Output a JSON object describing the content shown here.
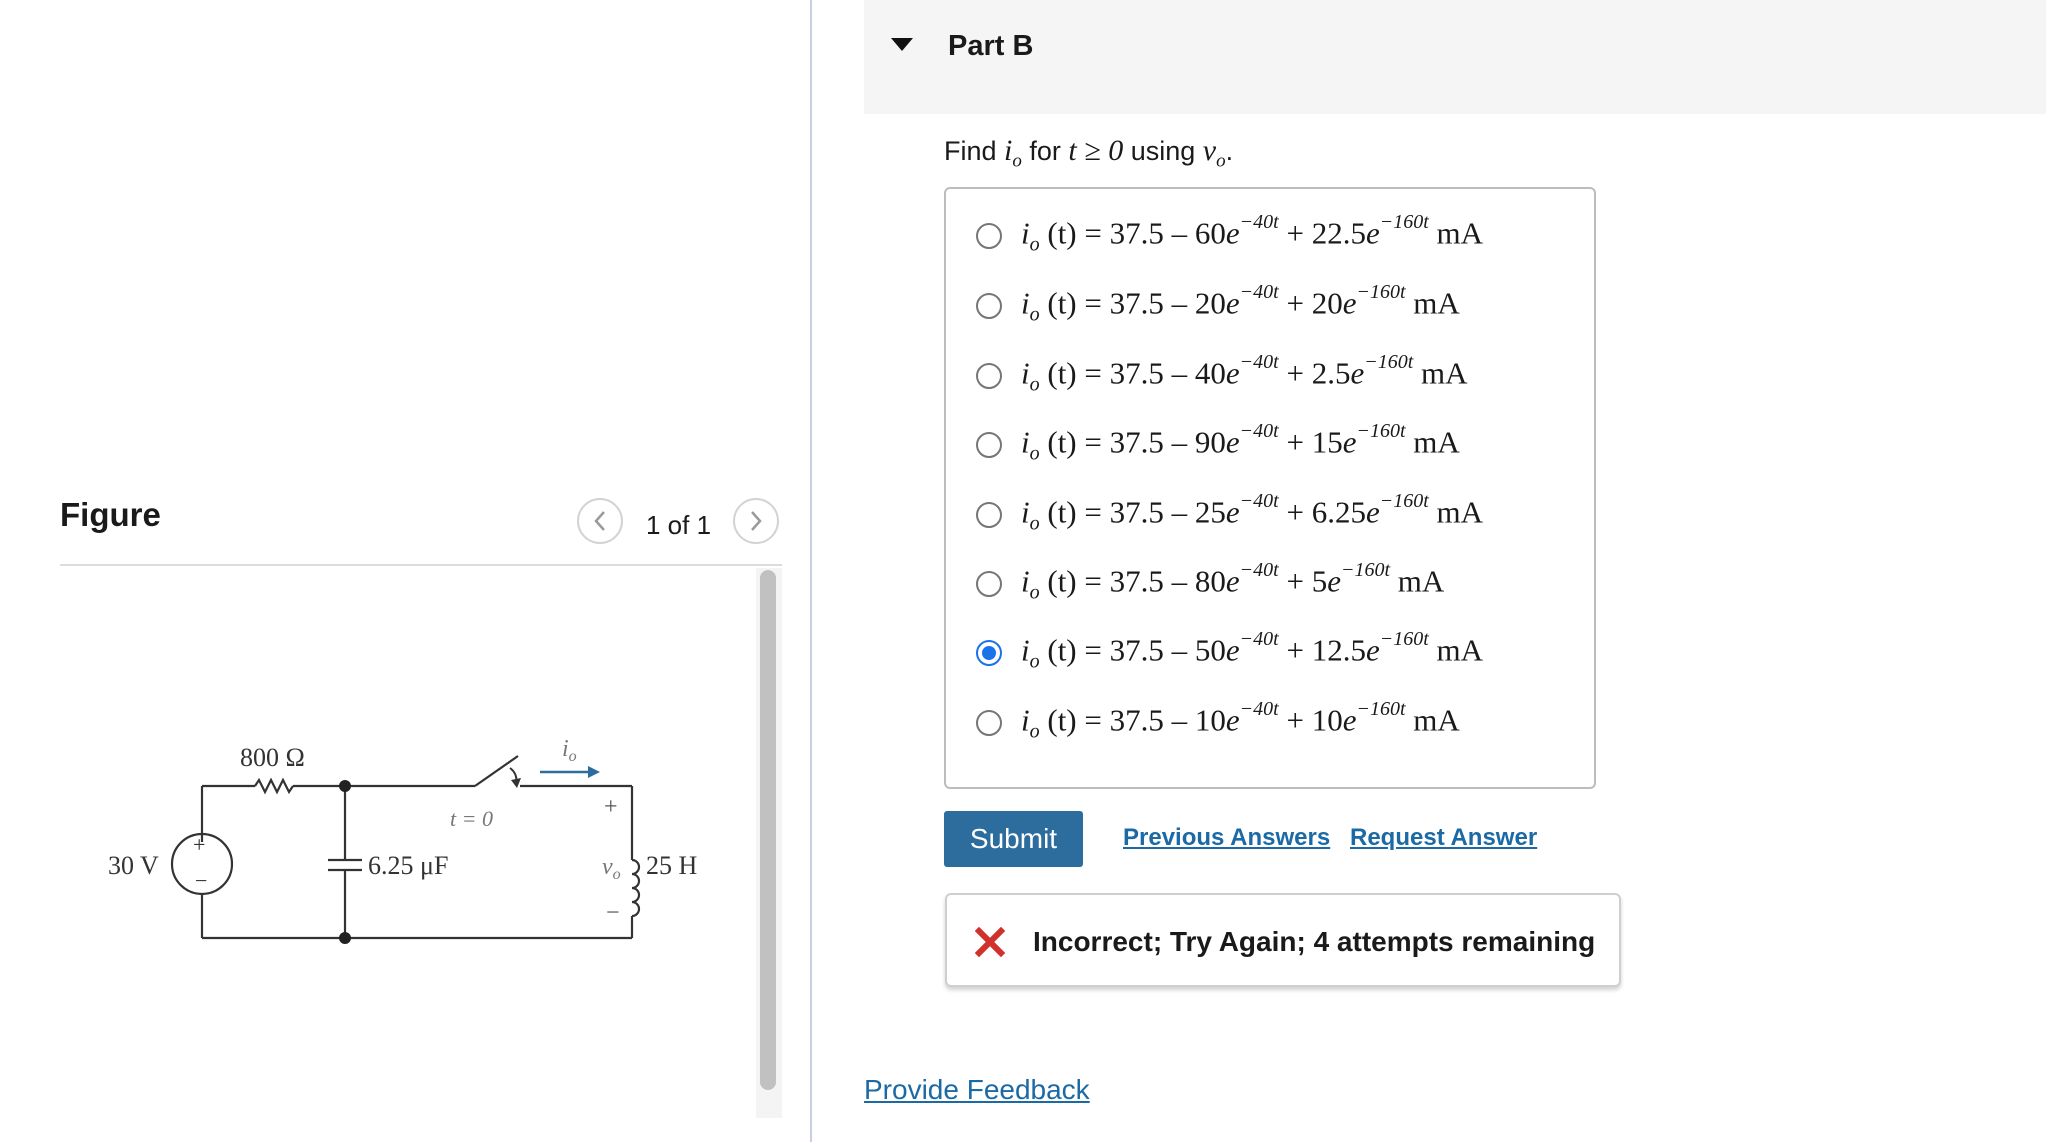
{
  "figure": {
    "title": "Figure",
    "page_counter": "1 of 1",
    "circuit": {
      "resistor_label": "800 Ω",
      "source_label": "30 V",
      "capacitor_label": "6.25 μF",
      "inductor_label": "25 H",
      "switch_label": "t = 0",
      "current_label": "i",
      "current_sub": "o",
      "voltage_label": "v",
      "voltage_sub": "o",
      "plus": "+",
      "minus": "−"
    }
  },
  "part": {
    "title": "Part B",
    "question_prefix": "Find ",
    "question_var": "i",
    "question_var_sub": "o",
    "question_mid": " for ",
    "question_cond": "t ≥ 0",
    "question_using": " using ",
    "question_using_var": "v",
    "question_using_sub": "o",
    "question_end": "."
  },
  "options": [
    {
      "a": "60",
      "b": "22.5",
      "selected": false
    },
    {
      "a": "20",
      "b": "20",
      "selected": false
    },
    {
      "a": "40",
      "b": "2.5",
      "selected": false
    },
    {
      "a": "90",
      "b": "15",
      "selected": false
    },
    {
      "a": "25",
      "b": "6.25",
      "selected": false
    },
    {
      "a": "80",
      "b": "5",
      "selected": false
    },
    {
      "a": "50",
      "b": "12.5",
      "selected": true
    },
    {
      "a": "10",
      "b": "10",
      "selected": false
    }
  ],
  "option_template": {
    "lhs_var": "i",
    "lhs_sub": "o",
    "lhs_arg": "(t)",
    "const": "= 37.5 –",
    "exp1": "−40t",
    "exp2": "−160t",
    "e": "e",
    "plus": "+",
    "unit": "mA"
  },
  "actions": {
    "submit": "Submit",
    "previous_answers": "Previous Answers",
    "request_answer": "Request Answer"
  },
  "feedback": {
    "message": "Incorrect; Try Again; 4 attempts remaining",
    "color": "#d0312d"
  },
  "footer": {
    "provide_feedback": "Provide Feedback"
  },
  "colors": {
    "accent": "#2d6d9e",
    "link": "#1b6aa5",
    "radio_selected": "#1a73e8"
  }
}
